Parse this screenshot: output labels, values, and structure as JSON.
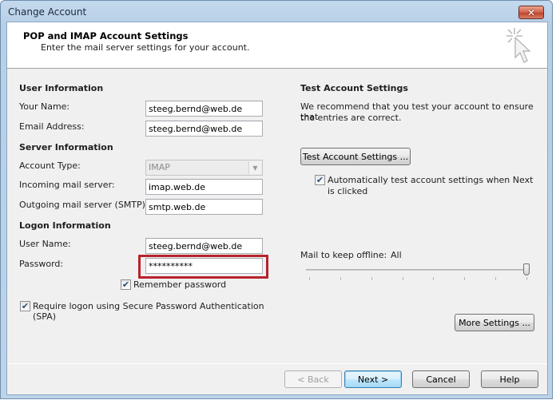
{
  "window": {
    "title": "Change Account",
    "close_label": "✕"
  },
  "header": {
    "title": "POP and IMAP Account Settings",
    "subtitle": "Enter the mail server settings for your account.",
    "icon": "cursor-sparkle-icon"
  },
  "user_information": {
    "section_title": "User Information",
    "your_name_label": "Your Name:",
    "your_name_value": "steeg.bernd@web.de",
    "email_label": "Email Address:",
    "email_value": "steeg.bernd@web.de"
  },
  "server_information": {
    "section_title": "Server Information",
    "account_type_label": "Account Type:",
    "account_type_value": "IMAP",
    "account_type_disabled": true,
    "incoming_label": "Incoming mail server:",
    "incoming_value": "imap.web.de",
    "outgoing_label": "Outgoing mail server (SMTP):",
    "outgoing_value": "smtp.web.de"
  },
  "logon_information": {
    "section_title": "Logon Information",
    "user_name_label": "User Name:",
    "user_name_value": "steeg.bernd@web.de",
    "password_label": "Password:",
    "password_value": "**********",
    "password_highlight_color": "#b7232b",
    "remember_password_label": "Remember password",
    "remember_password_checked": true,
    "spa_label_line1": "Require logon using Secure Password Authentication",
    "spa_label_line2": "(SPA)",
    "spa_checked": true
  },
  "test_account": {
    "section_title": "Test Account Settings",
    "description_line1": "We recommend that you test your account to ensure that",
    "description_line2": "the entries are correct.",
    "test_button_label": "Test Account Settings ...",
    "auto_test_label_line1": "Automatically test account settings when Next",
    "auto_test_label_line2": "is clicked",
    "auto_test_checked": true
  },
  "offline": {
    "label": "Mail to keep offline:",
    "value": "All",
    "slider_positions": 8,
    "slider_selected_index": 7
  },
  "more_settings_label": "More Settings ...",
  "footer": {
    "back_label": "< Back",
    "back_disabled": true,
    "next_label": "Next >",
    "cancel_label": "Cancel",
    "help_label": "Help"
  },
  "colors": {
    "default_button_border": "#3c7fb1",
    "close_button": "#c0432b"
  }
}
